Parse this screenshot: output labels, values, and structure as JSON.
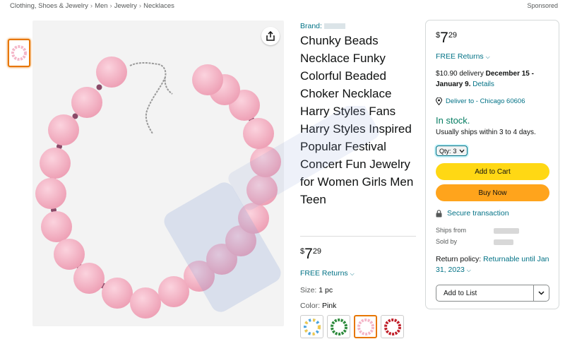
{
  "breadcrumb": [
    "Clothing, Shoes & Jewelry",
    "Men",
    "Jewelry",
    "Necklaces"
  ],
  "sponsored": "Sponsored",
  "product": {
    "brand": "Brand:",
    "title": "Chunky Beads Necklace Funky Colorful Beaded Choker Necklace Harry Styles Fans Harry Styles Inspired Popular Festival Concert Fun Jewelry for Women Girls Men Teen",
    "price": {
      "symbol": "$",
      "whole": "7",
      "fraction": "29"
    },
    "free_returns": "FREE Returns",
    "size_label": "Size:",
    "size_value": "1 pc",
    "color_label": "Color:",
    "color_value": "Pink"
  },
  "buybox": {
    "price": {
      "symbol": "$",
      "whole": "7",
      "fraction": "29"
    },
    "free_returns": "FREE Returns",
    "delivery_prefix": "$10.90 delivery ",
    "delivery_dates": "December 15 - January 9.",
    "delivery_details": "Details",
    "deliver_to": "Deliver to - Chicago 60606",
    "stock": "In stock.",
    "ships_note": "Usually ships within 3 to 4 days.",
    "qty_label": "Qty:",
    "qty_value": "3",
    "add_to_cart": "Add to Cart",
    "buy_now": "Buy Now",
    "secure": "Secure transaction",
    "ships_from": "Ships from",
    "sold_by": "Sold by",
    "return_prefix": "Return policy: ",
    "return_link": "Returnable until Jan 31, 2023",
    "add_to_list": "Add to List"
  },
  "colors": {
    "link": "#007185",
    "stock": "#067d62",
    "cart": "#ffd814",
    "buy": "#ffa41c",
    "selected": "#e77600",
    "bead": "#f4b6c8"
  },
  "icons": [
    "share-icon",
    "location-pin-icon",
    "lock-icon",
    "chevron-down-icon"
  ]
}
